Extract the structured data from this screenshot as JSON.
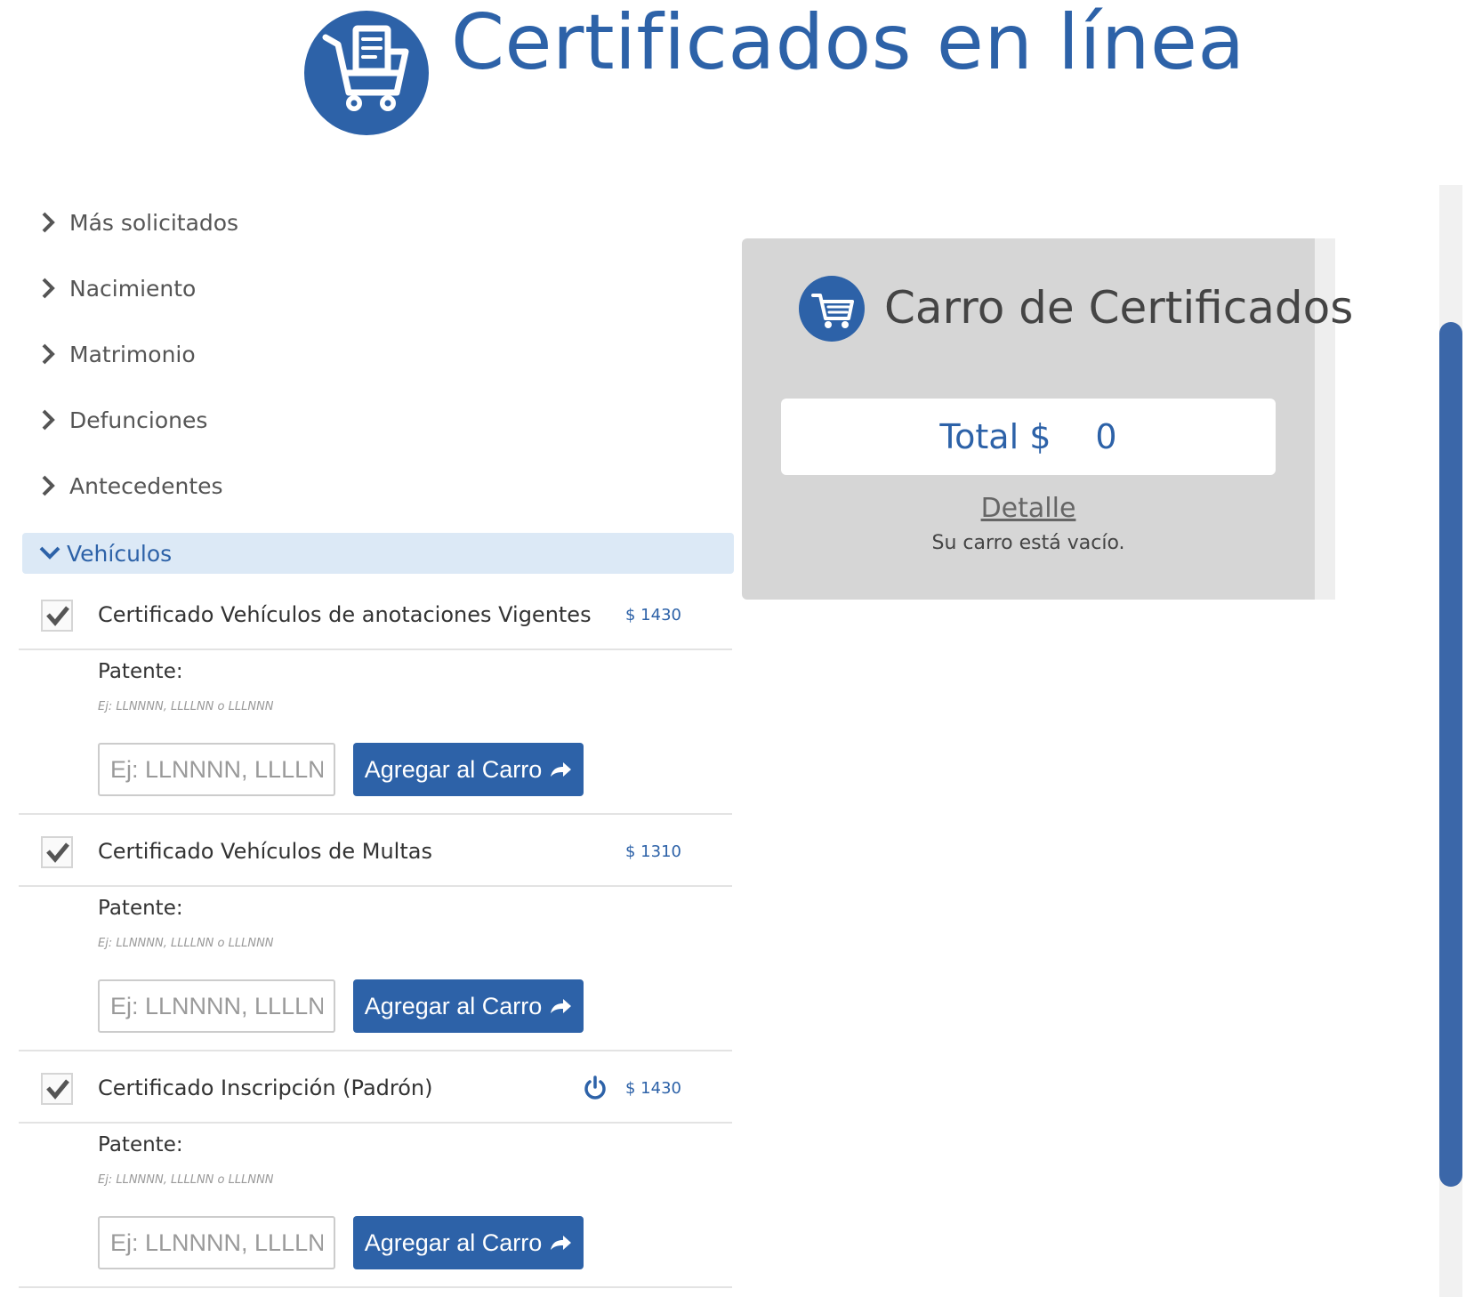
{
  "header": {
    "title": "Certificados en línea",
    "logo_icon": "certificate-cart-icon"
  },
  "categories": [
    {
      "label": "Más solicitados",
      "expanded": false
    },
    {
      "label": "Nacimiento",
      "expanded": false
    },
    {
      "label": "Matrimonio",
      "expanded": false
    },
    {
      "label": "Defunciones",
      "expanded": false
    },
    {
      "label": "Antecedentes",
      "expanded": false
    },
    {
      "label": "Vehículos",
      "expanded": true
    }
  ],
  "certificates": [
    {
      "name": "Certificado Vehículos de anotaciones Vigentes",
      "price": "$ 1430",
      "checked": true,
      "has_power_icon": false,
      "field_label": "Patente:",
      "hint": "Ej: LLNNNN, LLLLNN o LLLNNN",
      "placeholder": "Ej: LLNNNN, LLLLNN o LLLNNN",
      "value": "",
      "button_label": "Agregar al Carro"
    },
    {
      "name": "Certificado Vehículos de Multas",
      "price": "$ 1310",
      "checked": true,
      "has_power_icon": false,
      "field_label": "Patente:",
      "hint": "Ej: LLNNNN, LLLLNN o LLLNNN",
      "placeholder": "Ej: LLNNNN, LLLLNN o LLLNNN",
      "value": "",
      "button_label": "Agregar al Carro"
    },
    {
      "name": "Certificado Inscripción (Padrón)",
      "price": "$ 1430",
      "checked": true,
      "has_power_icon": true,
      "field_label": "Patente:",
      "hint": "Ej: LLNNNN, LLLLNN o LLLNNN",
      "placeholder": "Ej: LLNNNN, LLLLNN o LLLNNN",
      "value": "",
      "button_label": "Agregar al Carro"
    }
  ],
  "cart": {
    "title": "Carro de Certificados",
    "total_label": "Total $",
    "total_value": "0",
    "detail_link": "Detalle",
    "empty_message": "Su carro está vacío."
  },
  "colors": {
    "brand_blue": "#2d62a8",
    "active_category_bg": "#dce9f6",
    "cart_panel_bg": "#d6d6d6",
    "scrollbar_thumb": "#3b67a9"
  }
}
